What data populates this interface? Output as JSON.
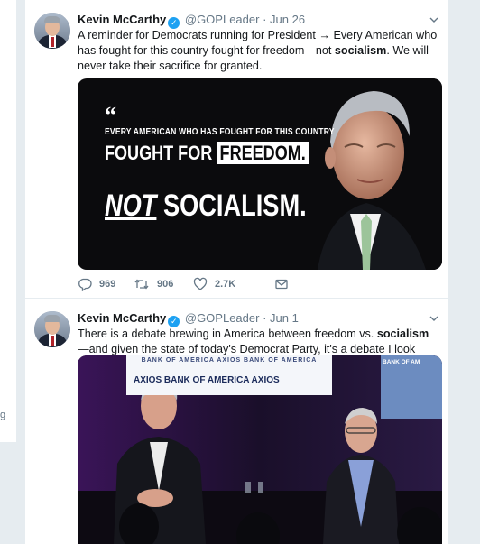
{
  "left_panel": {
    "clip_text": "g"
  },
  "tweets": [
    {
      "name": "Kevin McCarthy",
      "handle": "@GOPLeader",
      "dot": "·",
      "time": "Jun 26",
      "text": {
        "part1": "A reminder for Democrats running for President → Every American who has fought for this country fought for freedom—not ",
        "bold": "socialism",
        "part2": ". We will never take their sacrifice for granted."
      },
      "image": {
        "quote_mark": "“",
        "line1": "EVERY AMERICAN WHO HAS FOUGHT FOR THIS COUNTRY",
        "line2_prefix": "FOUGHT FOR ",
        "line2_highlight": "FREEDOM.",
        "line3_not": "NOT",
        "line3_rest": " SOCIALISM."
      },
      "actions": {
        "replies": "969",
        "retweets": "906",
        "likes": "2.7K"
      }
    },
    {
      "name": "Kevin McCarthy",
      "handle": "@GOPLeader",
      "dot": "·",
      "time": "Jun 1",
      "text": {
        "part1": "There is a debate brewing in America between freedom vs. ",
        "bold": "socialism",
        "part2": "—and given the state of today's Democrat Party, it's a debate I look forward to having."
      },
      "image": {
        "screen_top": "BANK OF AMERICA  AXIOS  BANK OF AMERICA",
        "screen_main": "AXIOS   BANK OF AMERICA   AXIOS",
        "screen_right": "BANK OF AM"
      }
    }
  ],
  "colors": {
    "verified": "#1da1f2",
    "muted": "#657786",
    "background": "#e6ecf0"
  },
  "icons": [
    "reply-icon",
    "retweet-icon",
    "like-icon",
    "direct-message-icon",
    "caret-down-icon",
    "verified-badge-icon"
  ]
}
